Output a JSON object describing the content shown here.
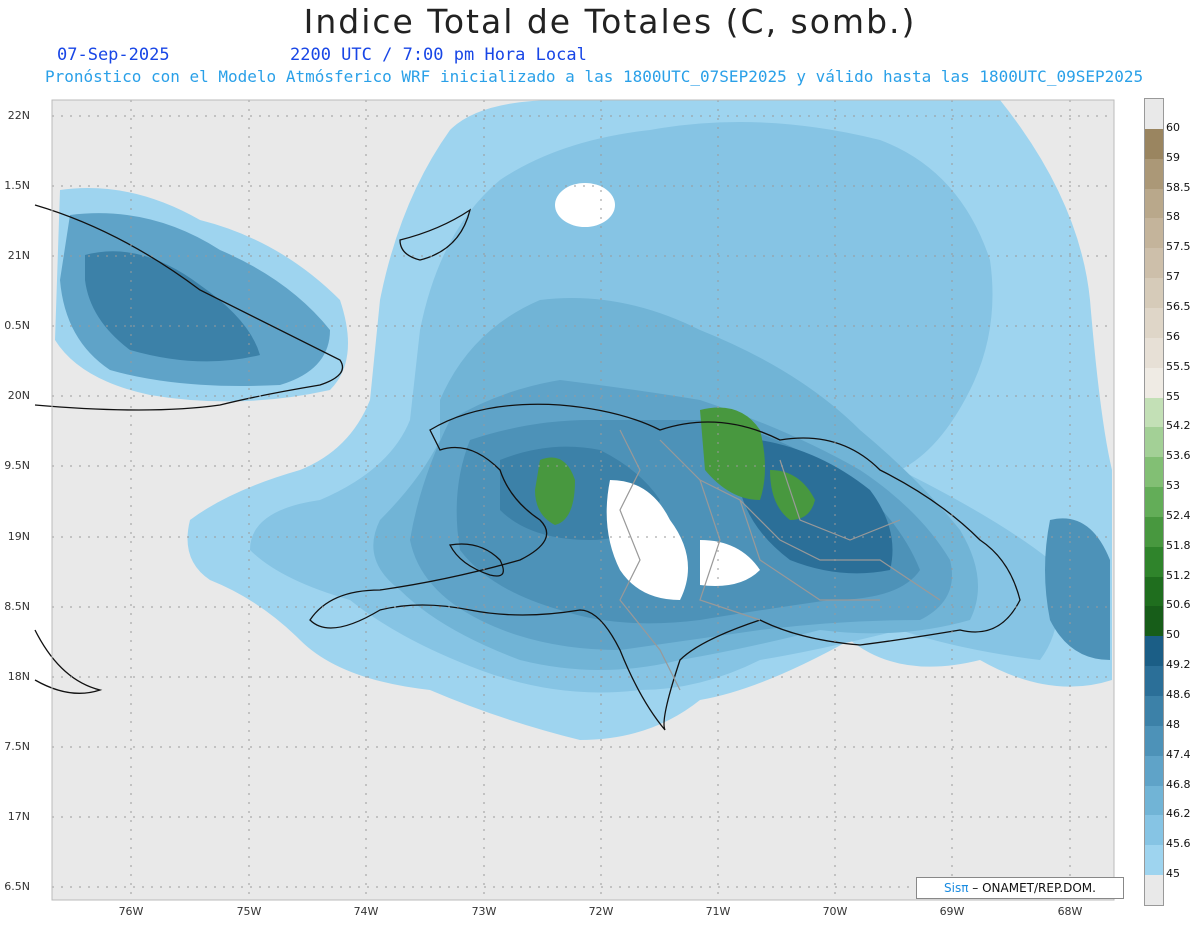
{
  "title": "Indice Total de Totales (C, somb.)",
  "header": {
    "date": "07-Sep-2025",
    "time": "2200 UTC / 7:00 pm Hora Local",
    "description": "Pronóstico con el Modelo Atmósferico WRF inicializado a las 1800UTC_07SEP2025 y válido hasta las  1800UTC_09SEP2025"
  },
  "map": {
    "region": "Hispaniola",
    "lat_labels": [
      "22N",
      "1.5N",
      "21N",
      "0.5N",
      "20N",
      "9.5N",
      "19N",
      "8.5N",
      "18N",
      "7.5N",
      "17N",
      "6.5N"
    ],
    "lon_labels": [
      "76W",
      "75W",
      "74W",
      "73W",
      "72W",
      "71W",
      "70W",
      "69W",
      "68W"
    ],
    "grid": true
  },
  "legend": {
    "levels": [
      "60",
      "59",
      "58.5",
      "58",
      "57.5",
      "57",
      "56.5",
      "56",
      "55.5",
      "55",
      "54.2",
      "53.6",
      "53",
      "52.4",
      "51.8",
      "51.2",
      "50.6",
      "50",
      "49.2",
      "48.6",
      "48",
      "47.4",
      "46.8",
      "46.2",
      "45.6",
      "45"
    ],
    "colors": [
      "#e9e9e9",
      "#9a8560",
      "#ab9877",
      "#b9a88b",
      "#c4b49b",
      "#cdbfaa",
      "#d6cbb9",
      "#dfd6c8",
      "#e7e0d6",
      "#efebe4",
      "#c3e0b6",
      "#a3d096",
      "#82bf74",
      "#63ad58",
      "#48983f",
      "#2f842b",
      "#1f6e1e",
      "#175d19",
      "#1b5e86",
      "#2b6f98",
      "#3c81a8",
      "#4d92b8",
      "#5fa3c8",
      "#71b4d6",
      "#86c4e4",
      "#9ed4ef",
      "#e9e9e9"
    ]
  },
  "credit": {
    "sis": "Sisπ",
    "text": "– ONAMET/REP.DOM."
  }
}
